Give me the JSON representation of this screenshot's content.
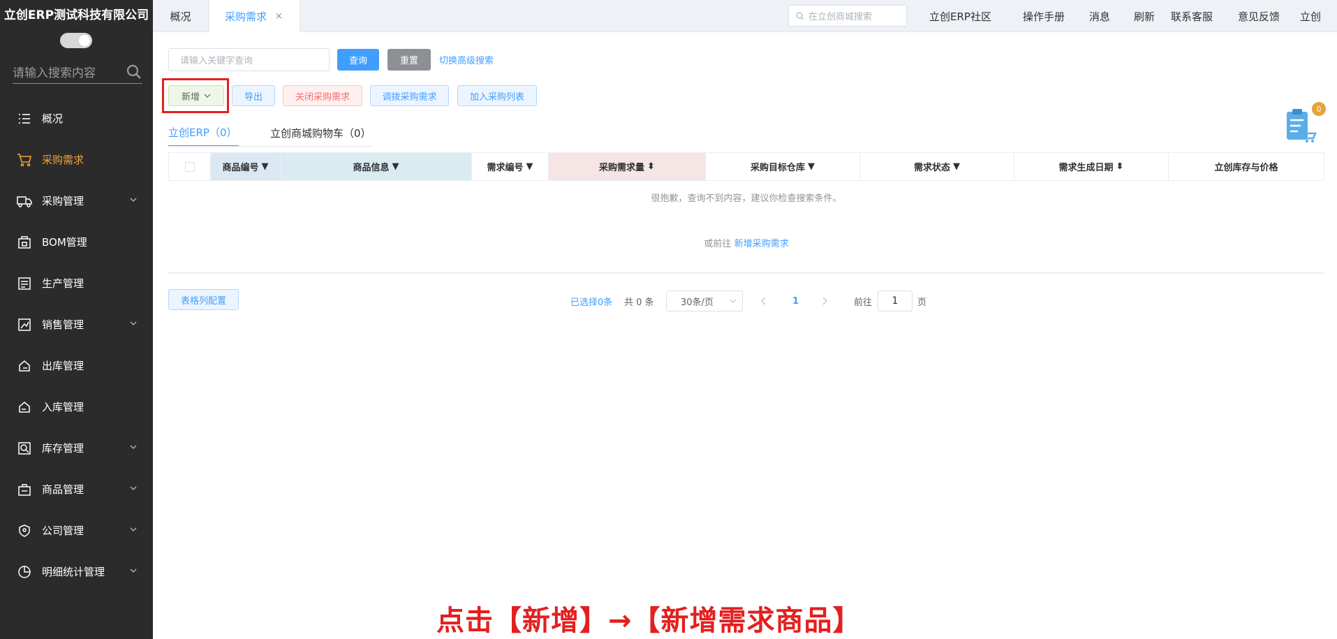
{
  "sidebar": {
    "company": "立创ERP测试科技有限公司",
    "search_placeholder": "请输入搜索内容",
    "items": [
      {
        "label": "概况",
        "icon": "list-icon"
      },
      {
        "label": "采购需求",
        "icon": "cart-icon",
        "active": true
      },
      {
        "label": "采购管理",
        "icon": "truck-icon"
      },
      {
        "label": "BOM管理",
        "icon": "bom-icon"
      },
      {
        "label": "生产管理",
        "icon": "production-icon"
      },
      {
        "label": "销售管理",
        "icon": "sales-icon"
      },
      {
        "label": "出库管理",
        "icon": "outbound-icon"
      },
      {
        "label": "入库管理",
        "icon": "inbound-icon"
      },
      {
        "label": "库存管理",
        "icon": "inventory-icon"
      },
      {
        "label": "商品管理",
        "icon": "goods-icon"
      },
      {
        "label": "公司管理",
        "icon": "shield-icon"
      },
      {
        "label": "明细统计管理",
        "icon": "pie-chart-icon"
      }
    ]
  },
  "topbar": {
    "tabs": [
      {
        "label": "概况"
      },
      {
        "label": "采购需求",
        "close": "×"
      }
    ],
    "search_placeholder": "在立创商城搜索",
    "links": [
      "立创ERP社区",
      "操作手册",
      "消息",
      "刷新",
      "联系客服",
      "意见反馈",
      "立创"
    ]
  },
  "filter": {
    "keyword_placeholder": "请输入关键字查询",
    "query_label": "查询",
    "reset_label": "重置",
    "advanced_label": "切换高级搜索"
  },
  "toolbar": {
    "new_label": "新增",
    "export_label": "导出",
    "close_label": "关闭采购需求",
    "transfer_label": "调拨采购需求",
    "addlist_label": "加入采购列表"
  },
  "subtabs": {
    "erp": "立创ERP（0）",
    "mall": "立创商城购物车（0）"
  },
  "cart_badge": "0",
  "table": {
    "headers": [
      "商品编号",
      "商品信息",
      "需求编号",
      "采购需求量",
      "采购目标仓库",
      "需求状态",
      "需求生成日期",
      "立创库存与价格"
    ],
    "empty_text": "很抱歉，查询不到内容，建议你检查搜索条件。",
    "alt_prefix": "或前往",
    "alt_link": "新增采购需求"
  },
  "footer": {
    "column_config": "表格列配置",
    "selected": "已选择0条",
    "total": "共 0 条",
    "page_size": "30条/页",
    "current_page": "1",
    "goto_label": "前往",
    "goto_value": "1",
    "page_unit": "页"
  },
  "instruction": "点击【新增】→【新增需求商品】",
  "colors": {
    "sidebar_bg": "#2b2b2b",
    "active": "#f0a23b",
    "primary": "#409eff",
    "danger": "#e41f1f"
  }
}
